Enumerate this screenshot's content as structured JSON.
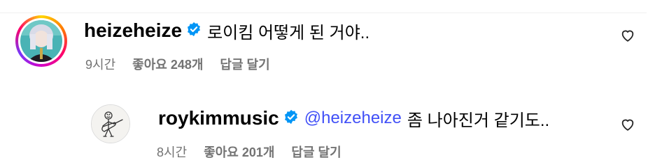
{
  "comments": [
    {
      "username": "heizeheize",
      "verified": true,
      "text": "로이킴 어떻게 된 거야..",
      "time": "9시간",
      "likes": "좋아요 248개",
      "reply": "답글 달기"
    },
    {
      "username": "roykimmusic",
      "verified": true,
      "mention": "@heizeheize",
      "text": "좀 나아진거 같기도..",
      "time": "8시간",
      "likes": "좋아요 201개",
      "reply": "답글 달기"
    }
  ],
  "colors": {
    "mention": "#4150f7",
    "verified": "#0095f6",
    "meta": "#737373"
  },
  "icons": [
    "verified-badge-icon",
    "heart-icon"
  ]
}
